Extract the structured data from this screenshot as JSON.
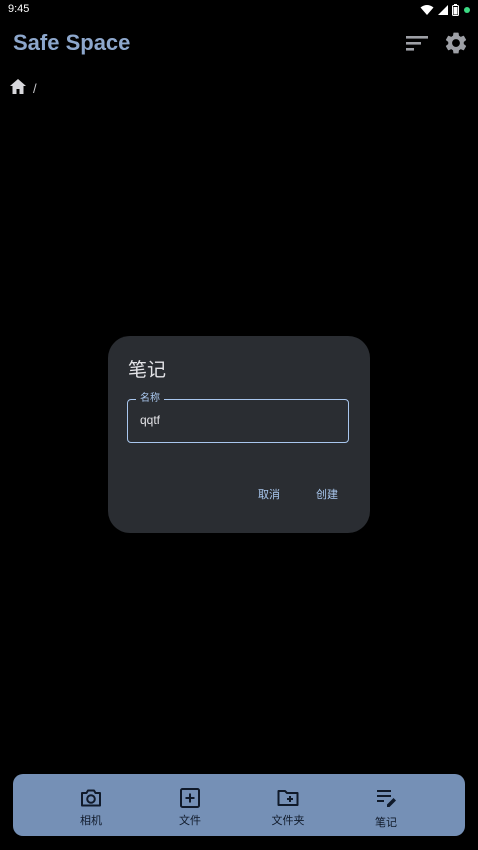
{
  "status_bar": {
    "time": "9:45"
  },
  "app_bar": {
    "title": "Safe Space"
  },
  "breadcrumb": {
    "separator": "/"
  },
  "dialog": {
    "title": "笔记",
    "field_label": "名称",
    "field_value": "qqtf",
    "cancel_label": "取消",
    "create_label": "创建"
  },
  "bottom_nav": {
    "items": [
      {
        "label": "相机",
        "icon": "camera-icon"
      },
      {
        "label": "文件",
        "icon": "add-box-icon"
      },
      {
        "label": "文件夹",
        "icon": "folder-add-icon"
      },
      {
        "label": "笔记",
        "icon": "note-edit-icon"
      }
    ]
  },
  "colors": {
    "background": "#000000",
    "accent": "#8da7cc",
    "dialog_bg": "#2a2d32",
    "field_outline": "#a9c7ee",
    "nav_bg": "#7590b6",
    "status_dot": "#3ddc84"
  }
}
